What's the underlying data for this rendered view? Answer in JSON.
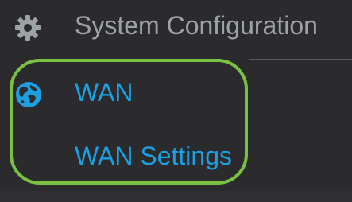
{
  "menu": {
    "section": {
      "title": "System Configuration",
      "icon": "gear-icon"
    },
    "wan": {
      "label": "WAN",
      "icon": "globe-icon"
    },
    "submenu": {
      "label": "WAN Settings"
    }
  },
  "colors": {
    "background": "#2b2b2e",
    "section_text": "#9da2a7",
    "link_text": "#1ba0e2",
    "highlight": "#7ac043"
  }
}
